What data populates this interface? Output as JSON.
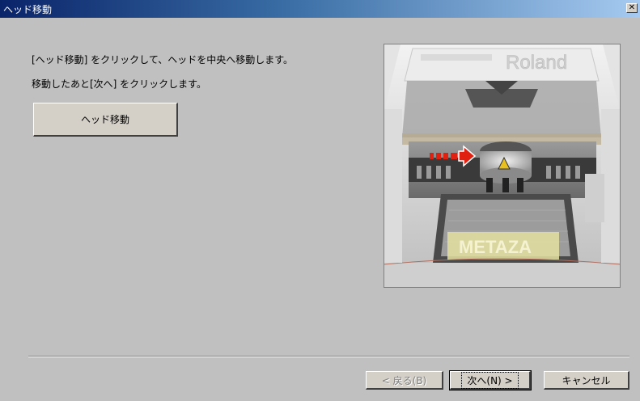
{
  "window": {
    "title": "ヘッド移動",
    "close_glyph": "✕"
  },
  "instructions": {
    "line1": "[ヘッド移動] をクリックして、ヘッドを中央へ移動します。",
    "line2": "移動したあと[次へ] をクリックします。"
  },
  "head_move_button": {
    "label": "ヘッド移動"
  },
  "photo": {
    "brand_text": "Roland",
    "plate_text": "METAZA",
    "arrow_color": "#e02010"
  },
  "footer": {
    "back_label": "< 戻る(B)",
    "next_label": "次へ(N) >",
    "cancel_label": "キャンセル"
  }
}
